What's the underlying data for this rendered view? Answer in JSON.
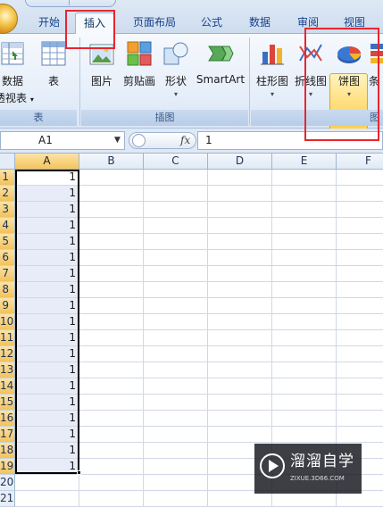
{
  "tabs": [
    {
      "label": "开始",
      "active": false
    },
    {
      "label": "插入",
      "active": true
    },
    {
      "label": "页面布局",
      "active": false
    },
    {
      "label": "公式",
      "active": false
    },
    {
      "label": "数据",
      "active": false
    },
    {
      "label": "审阅",
      "active": false
    },
    {
      "label": "视图",
      "active": false
    }
  ],
  "ribbon": {
    "groups": {
      "table": "表",
      "illustrations": "插图",
      "charts": "图"
    },
    "buttons": {
      "pivot_line1": "数据",
      "pivot_line2": "透视表",
      "table": "表",
      "picture": "图片",
      "clipart": "剪贴画",
      "shapes": "形状",
      "smartart": "SmartArt",
      "column_chart": "柱形图",
      "line_chart": "折线图",
      "pie_chart": "饼图",
      "bar_chart": "条"
    }
  },
  "formula_bar": {
    "name_box": "A1",
    "fx_label": "fx",
    "value": "1"
  },
  "columns": [
    "A",
    "B",
    "C",
    "D",
    "E",
    "F"
  ],
  "rows": [
    "1",
    "2",
    "3",
    "4",
    "5",
    "6",
    "7",
    "8",
    "9",
    "10",
    "11",
    "12",
    "13",
    "14",
    "15",
    "16",
    "17",
    "18",
    "19",
    "20",
    "21"
  ],
  "column_a_values": [
    "1",
    "1",
    "1",
    "1",
    "1",
    "1",
    "1",
    "1",
    "1",
    "1",
    "1",
    "1",
    "1",
    "1",
    "1",
    "1",
    "1",
    "1",
    "1",
    "",
    ""
  ],
  "watermark": {
    "title": "溜溜自学",
    "subtitle": "ZIXUE.3D66.COM"
  },
  "colors": {
    "highlight_red": "#e8262f",
    "selected_header": "#f6c45c",
    "tab_text": "#15428b"
  }
}
